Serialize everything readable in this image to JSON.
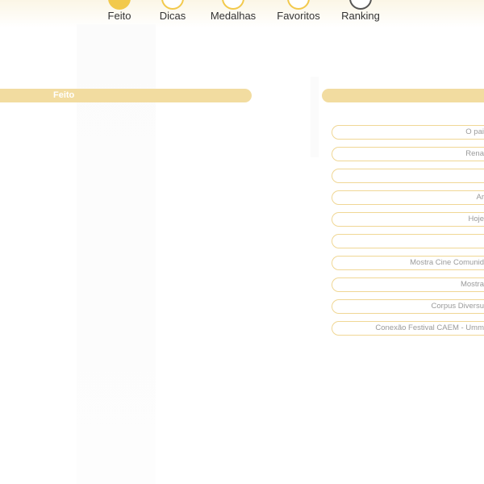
{
  "nav": {
    "items": [
      {
        "label": "Feito"
      },
      {
        "label": "Dicas"
      },
      {
        "label": "Medalhas"
      },
      {
        "label": "Favoritos"
      },
      {
        "label": "Ranking"
      }
    ]
  },
  "left_panel": {
    "header": "Feito"
  },
  "right_panel": {
    "header": "",
    "items": [
      {
        "label": "O pai"
      },
      {
        "label": "Rena"
      },
      {
        "label": ""
      },
      {
        "label": "Ar"
      },
      {
        "label": "Hoje"
      },
      {
        "label": ""
      },
      {
        "label": "Mostra Cine Comunid"
      },
      {
        "label": "Mostra"
      },
      {
        "label": "Corpus Diversu"
      },
      {
        "label": "Conexão Festival CAEM - Umm"
      }
    ]
  },
  "colors": {
    "accent": "#f2c94c",
    "header_bar": "#f2dca0",
    "pill_border": "#f0d795"
  }
}
